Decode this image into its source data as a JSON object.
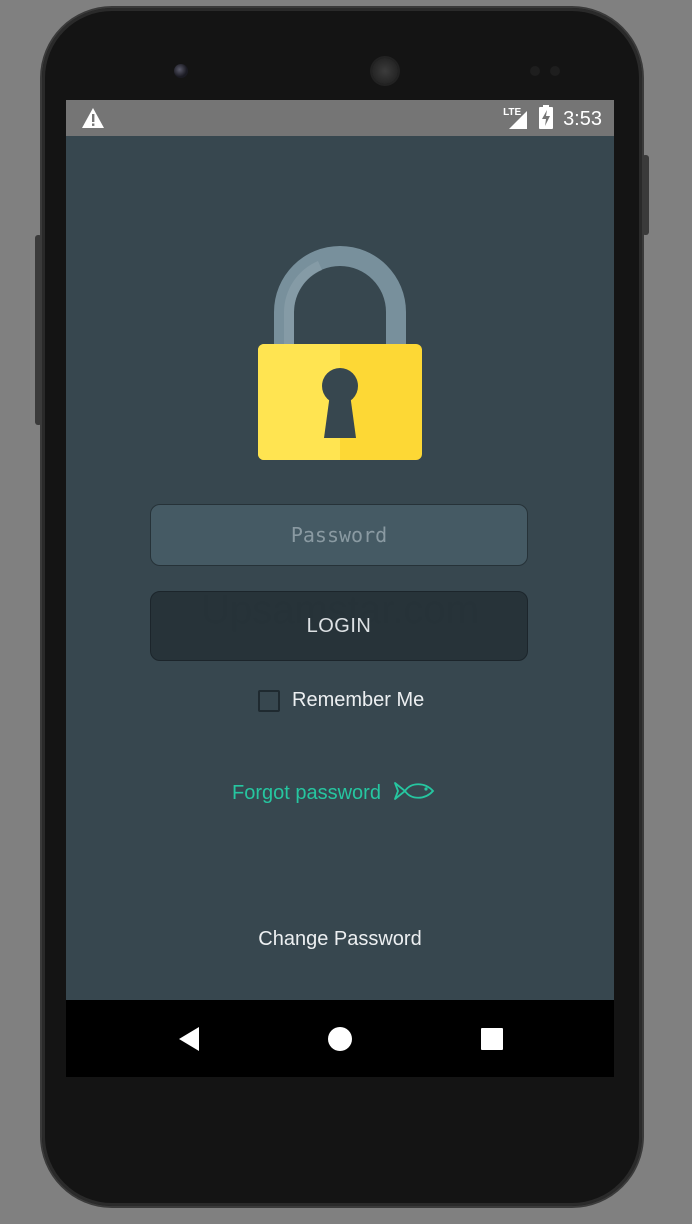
{
  "status_bar": {
    "time": "3:53",
    "network_label": "LTE",
    "icons": [
      "warning-icon",
      "signal-icon",
      "battery-charging-icon"
    ]
  },
  "login_form": {
    "password_placeholder": "Password",
    "login_label": "LOGIN",
    "remember_me_label": "Remember Me",
    "remember_me_checked": false,
    "forgot_password_label": "Forgot password",
    "change_password_label": "Change Password",
    "watermark_text": "Upsamstar.com"
  },
  "colors": {
    "background": "#37474f",
    "status_bar": "#757575",
    "accent": "#26c6a0",
    "lock_body": "#fdd835",
    "lock_shackle": "#78909c"
  },
  "navigation": {
    "items": [
      "back-icon",
      "home-icon",
      "recents-icon"
    ]
  }
}
